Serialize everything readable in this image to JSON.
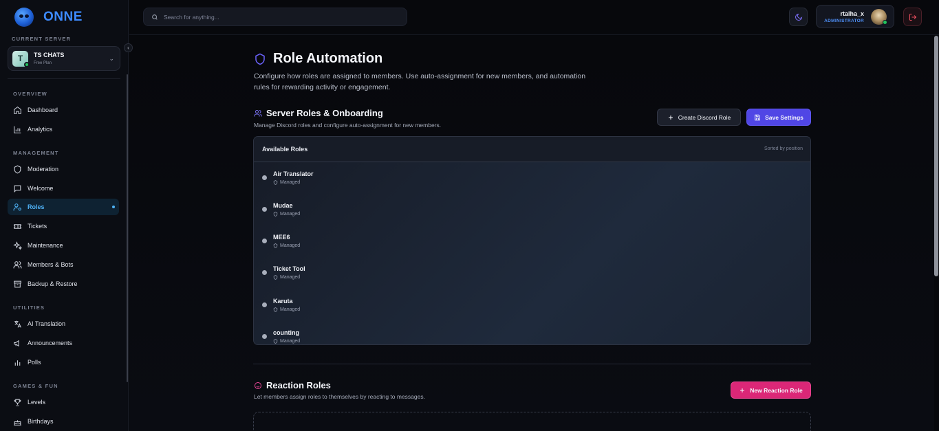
{
  "brand": {
    "name": "ONNE"
  },
  "sidebar": {
    "current_server_label": "CURRENT SERVER",
    "server": {
      "initial": "T",
      "name": "TS CHATS",
      "plan": "Free Plan"
    },
    "sections": [
      {
        "label": "OVERVIEW",
        "items": [
          {
            "label": "Dashboard",
            "icon": "home-icon"
          },
          {
            "label": "Analytics",
            "icon": "chart-icon"
          }
        ]
      },
      {
        "label": "MANAGEMENT",
        "items": [
          {
            "label": "Moderation",
            "icon": "shield-icon"
          },
          {
            "label": "Welcome",
            "icon": "message-icon"
          },
          {
            "label": "Roles",
            "icon": "user-cog-icon",
            "active": true
          },
          {
            "label": "Tickets",
            "icon": "ticket-icon"
          },
          {
            "label": "Maintenance",
            "icon": "sparkles-icon"
          },
          {
            "label": "Members & Bots",
            "icon": "users-icon"
          },
          {
            "label": "Backup & Restore",
            "icon": "archive-icon"
          }
        ]
      },
      {
        "label": "UTILITIES",
        "items": [
          {
            "label": "AI Translation",
            "icon": "translate-icon"
          },
          {
            "label": "Announcements",
            "icon": "megaphone-icon"
          },
          {
            "label": "Polls",
            "icon": "bar-chart-icon"
          }
        ]
      },
      {
        "label": "GAMES & FUN",
        "items": [
          {
            "label": "Levels",
            "icon": "trophy-icon"
          },
          {
            "label": "Birthdays",
            "icon": "cake-icon"
          }
        ]
      }
    ]
  },
  "topbar": {
    "search_placeholder": "Search for anything...",
    "user": {
      "name": "rtalha_x",
      "role": "ADMINISTRATOR"
    }
  },
  "page": {
    "title": "Role Automation",
    "description": "Configure how roles are assigned to members. Use auto-assignment for new members, and automation rules for rewarding activity or engagement."
  },
  "server_roles": {
    "title": "Server Roles & Onboarding",
    "subtitle": "Manage Discord roles and configure auto-assignment for new members.",
    "create_button": "Create Discord Role",
    "save_button": "Save Settings",
    "panel_title": "Available Roles",
    "panel_sort": "Sorted by position",
    "roles": [
      {
        "name": "Air Translator",
        "status": "Managed"
      },
      {
        "name": "Mudae",
        "status": "Managed"
      },
      {
        "name": "MEE6",
        "status": "Managed"
      },
      {
        "name": "Ticket Tool",
        "status": "Managed"
      },
      {
        "name": "Karuta",
        "status": "Managed"
      },
      {
        "name": "counting",
        "status": "Managed"
      }
    ]
  },
  "reaction_roles": {
    "title": "Reaction Roles",
    "subtitle": "Let members assign roles to themselves by reacting to messages.",
    "new_button": "New Reaction Role"
  },
  "colors": {
    "accent": "#5046e5",
    "active_nav": "#4eb1f5",
    "pink": "#db2777",
    "brand": "#3d8bff"
  }
}
